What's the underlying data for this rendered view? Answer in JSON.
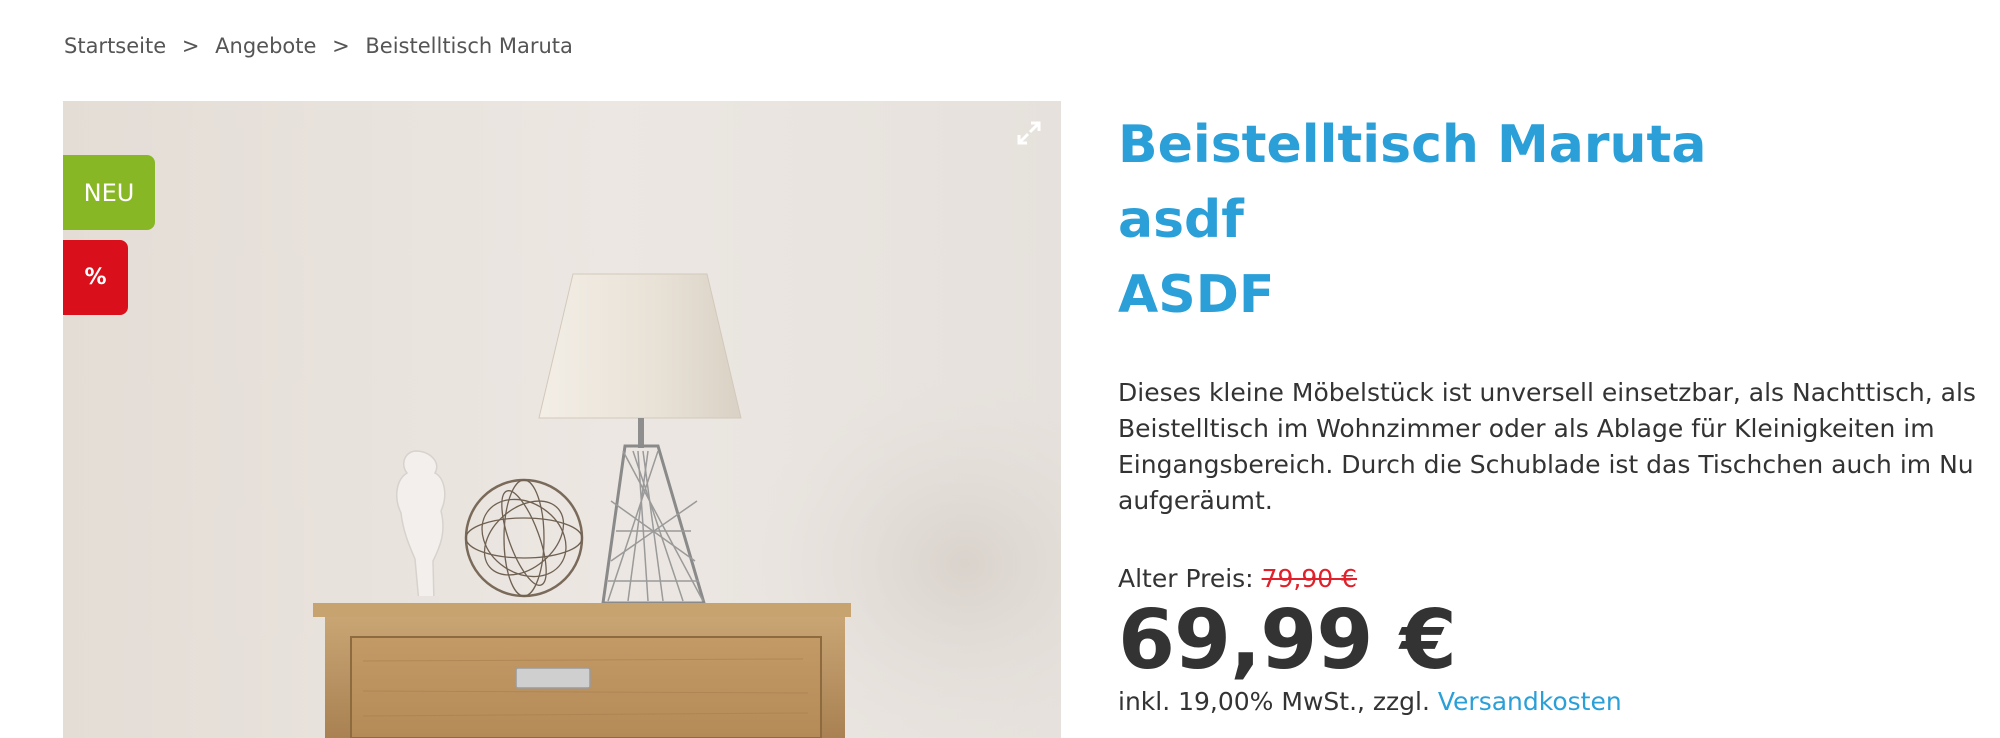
{
  "breadcrumb": {
    "items": [
      "Startseite",
      "Angebote"
    ],
    "separator": ">",
    "current": "Beistelltisch Maruta"
  },
  "gallery": {
    "image_subject": "side table with lamp, sculpture and wire ball",
    "expand_icon": "expand-icon"
  },
  "badges": {
    "new_label": "NEU",
    "sale_label": "%",
    "new_color": "#88b726",
    "sale_color": "#d9101b"
  },
  "product": {
    "title_line1": "Beistelltisch Maruta",
    "title_line2": "asdf",
    "title_line3": "ASDF",
    "description_lines": [
      "Dieses kleine Möbelstück ist unversell einsetzbar, als Nachttisch, als",
      "Beistelltisch im Wohnzimmer oder als Ablage für Kleinigkeiten im",
      "Eingangsbereich. Durch die Schublade ist das Tischchen auch im Nu",
      "aufgeräumt."
    ],
    "old_price_label": "Alter Preis:",
    "old_price": "79,90 €",
    "price": "69,99 €",
    "tax_text": "inkl. 19,00% MwSt., zzgl.",
    "shipping_link": "Versandkosten"
  },
  "colors": {
    "accent": "#2a9fd8",
    "old_price": "#e0202a"
  }
}
